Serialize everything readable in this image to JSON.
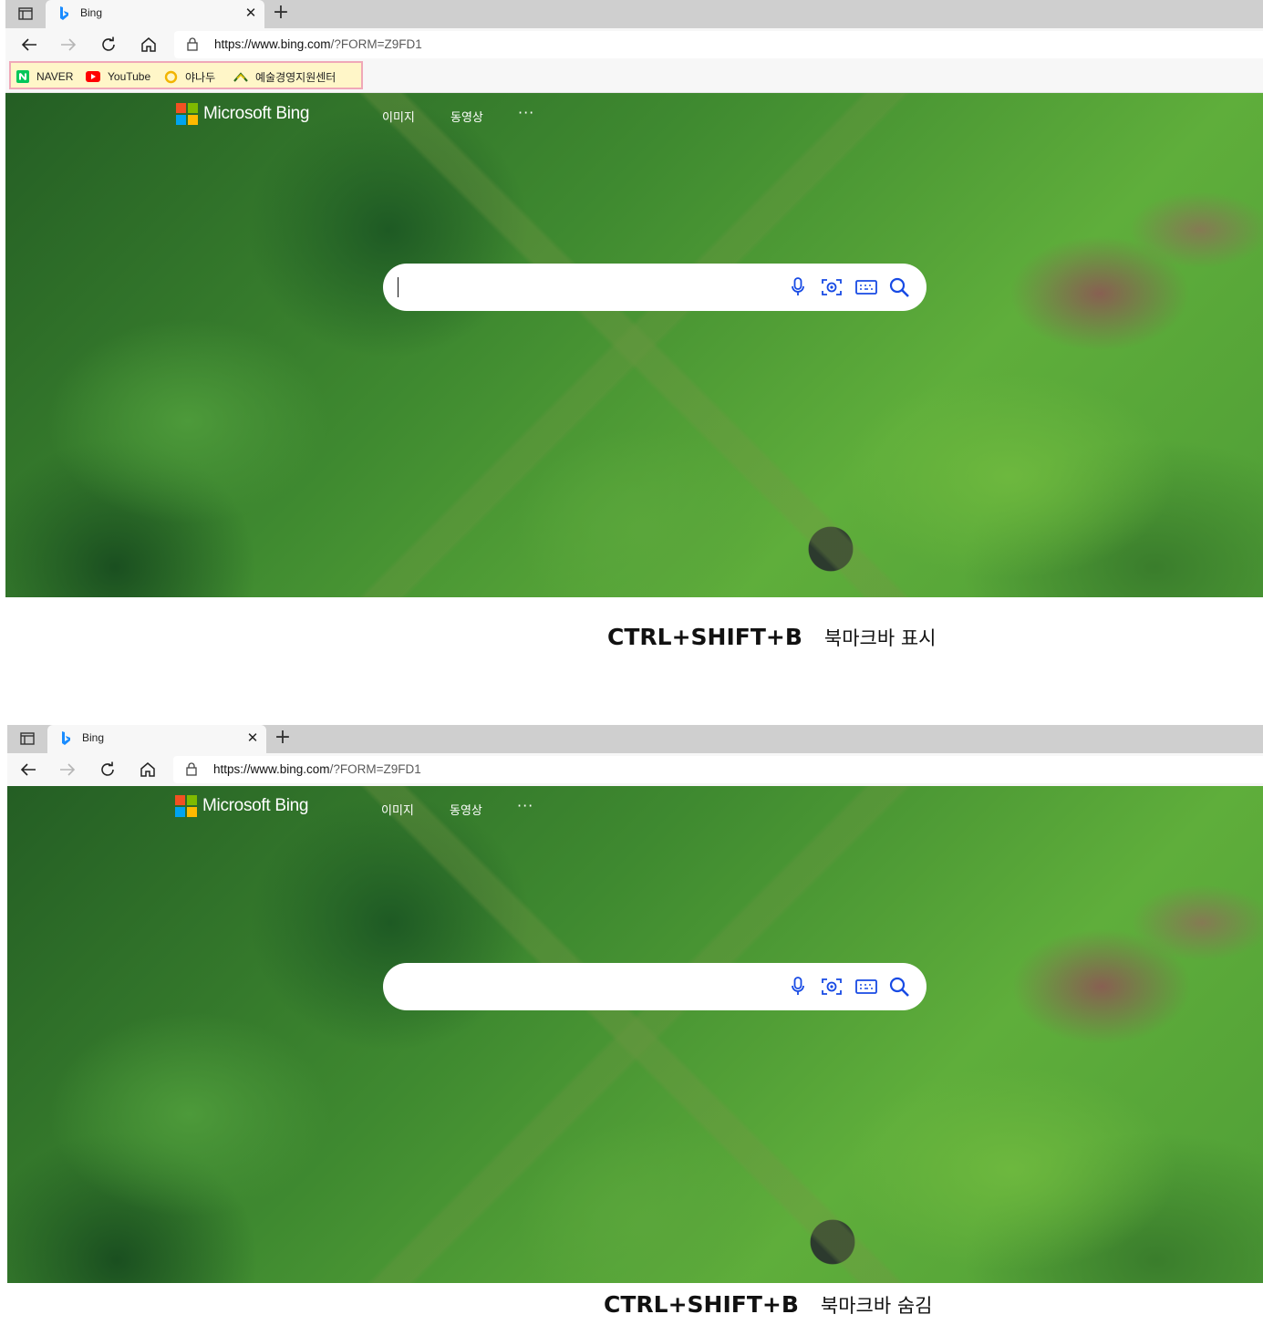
{
  "colors": {
    "tabstrip": "#cfcfcf",
    "toolbar": "#f7f7f7",
    "bookmark_highlight_fill": "#fff6c8",
    "bookmark_highlight_border": "#f0a8b8",
    "ms_red": "#f25022",
    "ms_green": "#7fba00",
    "ms_blue": "#00a4ef",
    "ms_yellow": "#ffb900",
    "naver_green": "#03c75a",
    "youtube_red": "#ff0000"
  },
  "screenshot1": {
    "tab": {
      "title": "Bing",
      "favicon": "bing-icon"
    },
    "address": {
      "host": "https://www.bing.com",
      "rest": "/?FORM=Z9FD1"
    },
    "bookmarks": [
      {
        "label": "NAVER",
        "icon": "naver-icon"
      },
      {
        "label": "YouTube",
        "icon": "youtube-icon"
      },
      {
        "label": "야나두",
        "icon": "yanadoo-icon"
      },
      {
        "label": "예술경영지원센터",
        "icon": "gokams-icon"
      }
    ],
    "brand": "Microsoft Bing",
    "nav": {
      "images": "이미지",
      "videos": "동영상",
      "more": "···"
    },
    "caption": {
      "keys": "CTRL+SHIFT+B",
      "desc": "북마크바 표시"
    }
  },
  "screenshot2": {
    "tab": {
      "title": "Bing",
      "favicon": "bing-icon"
    },
    "address": {
      "host": "https://www.bing.com",
      "rest": "/?FORM=Z9FD1"
    },
    "brand": "Microsoft Bing",
    "nav": {
      "images": "이미지",
      "videos": "동영상",
      "more": "···"
    },
    "caption": {
      "keys": "CTRL+SHIFT+B",
      "desc": "북마크바 숨김"
    }
  }
}
